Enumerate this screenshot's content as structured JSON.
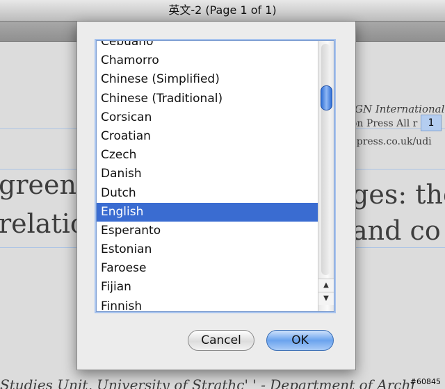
{
  "window": {
    "title": "英文-2 (Page 1 of 1)"
  },
  "document": {
    "frag1": "GN International",
    "frag2": "on Press All r",
    "frag3": "-press.co.uk/udi",
    "big1": "green be",
    "big1b": "ges: the",
    "big2": "relatio",
    "big2b": "and co",
    "footer": "Studies Unit, University of Strathc'   ' - Department of Archi",
    "page_badge": "1",
    "watermark": "#60845"
  },
  "language_list": {
    "items": [
      "Cebuano",
      "Chamorro",
      "Chinese (Simplified)",
      "Chinese (Traditional)",
      "Corsican",
      "Croatian",
      "Czech",
      "Danish",
      "Dutch",
      "English",
      "Esperanto",
      "Estonian",
      "Faroese",
      "Fijian",
      "Finnish"
    ],
    "selected": "English"
  },
  "buttons": {
    "cancel": "Cancel",
    "ok": "OK"
  },
  "colors": {
    "selection": "#3a6cd1",
    "ok_button": "#6aa3ee",
    "focus_ring": "#a7c3ee"
  },
  "icons": {
    "scroll_up": "up-triangle",
    "scroll_down": "down-triangle"
  }
}
